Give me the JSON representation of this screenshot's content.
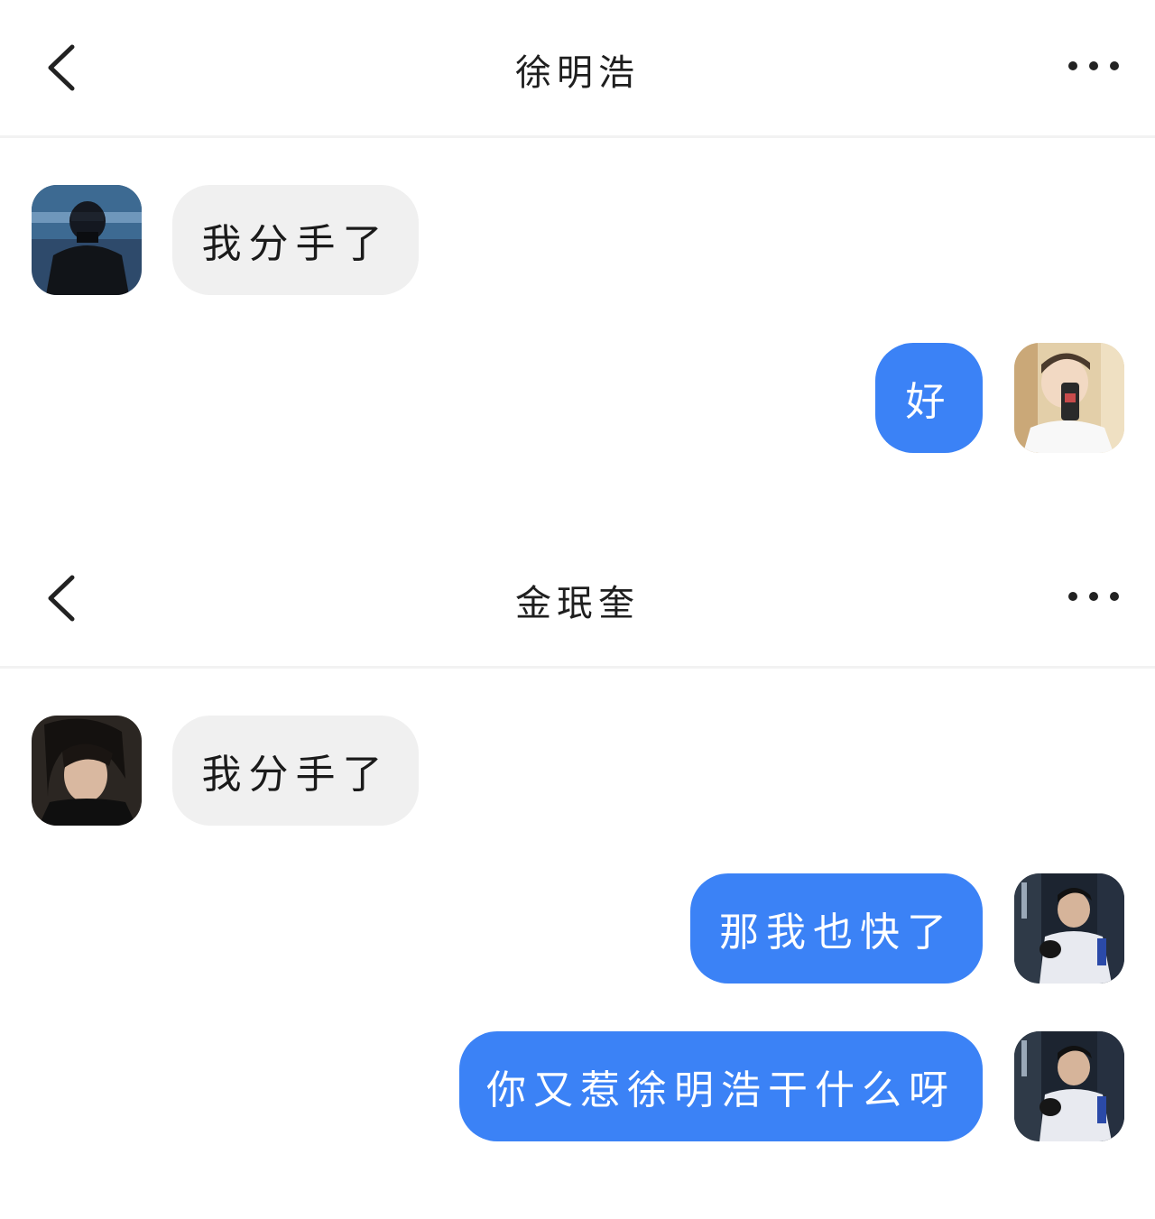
{
  "chats": [
    {
      "title": "徐明浩",
      "messages": [
        {
          "direction": "incoming",
          "text": "我分手了"
        },
        {
          "direction": "outgoing",
          "text": "好"
        }
      ]
    },
    {
      "title": "金珉奎",
      "messages": [
        {
          "direction": "incoming",
          "text": "我分手了"
        },
        {
          "direction": "outgoing",
          "text": "那我也快了"
        },
        {
          "direction": "outgoing",
          "text": "你又惹徐明浩干什么呀"
        }
      ]
    }
  ],
  "icons": {
    "back": "chevron-left-icon",
    "more": "more-dots-icon"
  },
  "colors": {
    "outgoing_bubble": "#3b82f6",
    "incoming_bubble": "#f0f0f0",
    "background": "#ffffff"
  }
}
